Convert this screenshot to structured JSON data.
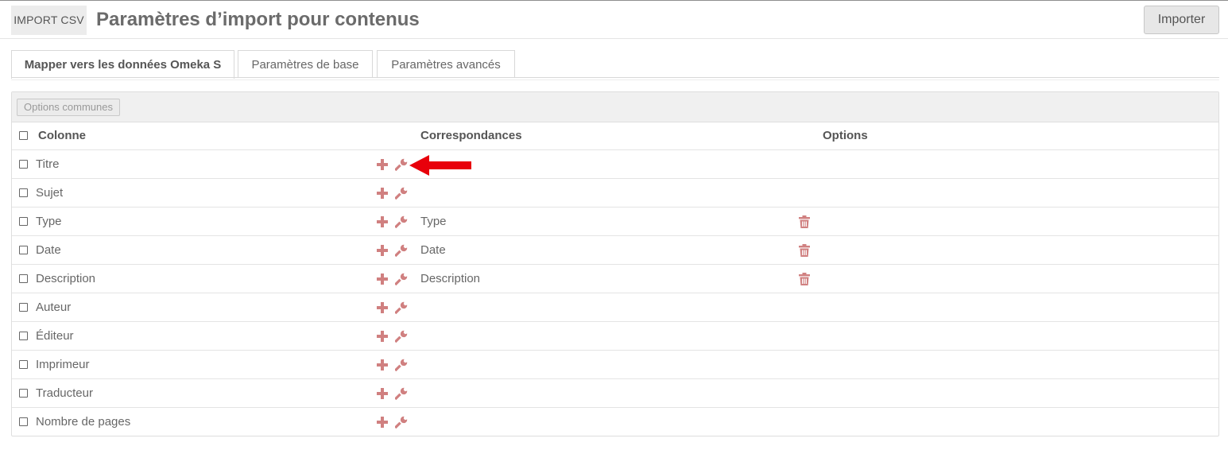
{
  "header": {
    "module_badge": "IMPORT CSV",
    "title": "Paramètres d’import pour contenus",
    "import_button": "Importer"
  },
  "tabs": [
    {
      "label": "Mapper vers les données Omeka S",
      "active": true
    },
    {
      "label": "Paramètres de base",
      "active": false
    },
    {
      "label": "Paramètres avancés",
      "active": false
    }
  ],
  "toolbar": {
    "common_options_button": "Options communes"
  },
  "table": {
    "headers": {
      "column": "Colonne",
      "mappings": "Correspondances",
      "options": "Options"
    },
    "rows": [
      {
        "column": "Titre",
        "mapping": ""
      },
      {
        "column": "Sujet",
        "mapping": ""
      },
      {
        "column": "Type",
        "mapping": "Type"
      },
      {
        "column": "Date",
        "mapping": "Date"
      },
      {
        "column": "Description",
        "mapping": "Description"
      },
      {
        "column": "Auteur",
        "mapping": ""
      },
      {
        "column": "Éditeur",
        "mapping": ""
      },
      {
        "column": "Imprimeur",
        "mapping": ""
      },
      {
        "column": "Traducteur",
        "mapping": ""
      },
      {
        "column": "Nombre de pages",
        "mapping": ""
      }
    ]
  },
  "icons": {
    "add": "plus-icon",
    "configure": "wrench-icon",
    "delete": "trash-icon",
    "annotation": "red-arrow-left"
  },
  "colors": {
    "action_icon": "#d08080",
    "annotation_arrow": "#e8000b"
  }
}
